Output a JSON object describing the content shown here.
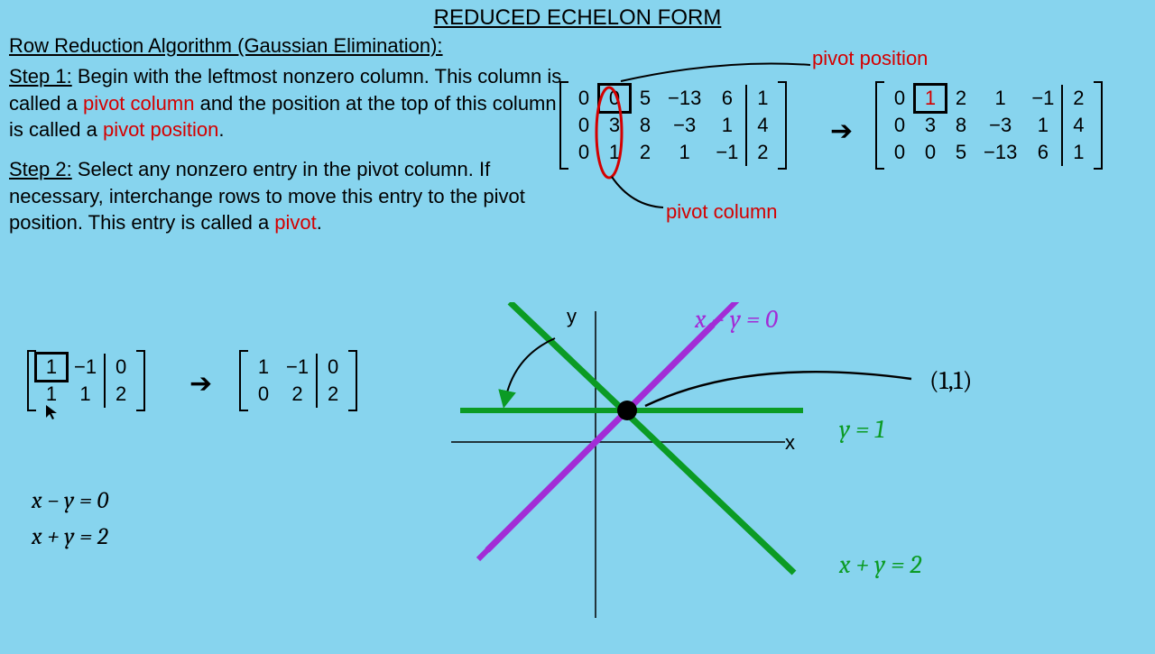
{
  "title": "REDUCED ECHELON FORM",
  "subtitle": "Row Reduction Algorithm (Gaussian Elimination):",
  "labels": {
    "pivot_position": "pivot position",
    "pivot_column": "pivot column"
  },
  "step1": {
    "label": "Step 1:",
    "t1": " Begin with the leftmost nonzero column. This column is called a ",
    "pc": "pivot column",
    "t2": " and the position at the top of this column is called a ",
    "pp": "pivot position",
    "t3": "."
  },
  "step2": {
    "label": "Step 2:",
    "t1": " Select any nonzero entry in the pivot column. If necessary, interchange rows to move this entry to the pivot position. This entry is called a ",
    "pivot": "pivot",
    "t2": "."
  },
  "matrixA": {
    "rows": [
      [
        "0",
        "0",
        "5",
        "−13",
        "6",
        "1"
      ],
      [
        "0",
        "3",
        "8",
        "−3",
        "1",
        "4"
      ],
      [
        "0",
        "1",
        "2",
        "1",
        "−1",
        "2"
      ]
    ]
  },
  "matrixB": {
    "rows": [
      [
        "0",
        "1",
        "2",
        "1",
        "−1",
        "2"
      ],
      [
        "0",
        "3",
        "8",
        "−3",
        "1",
        "4"
      ],
      [
        "0",
        "0",
        "5",
        "−13",
        "6",
        "1"
      ]
    ]
  },
  "matrixC": {
    "rows": [
      [
        "1",
        "−1",
        "0"
      ],
      [
        "1",
        "1",
        "2"
      ]
    ]
  },
  "matrixD": {
    "rows": [
      [
        "1",
        "−1",
        "0"
      ],
      [
        "0",
        "2",
        "2"
      ]
    ]
  },
  "equations": {
    "e1": "x − y = 0",
    "e2": "x + y = 2"
  },
  "graph": {
    "xlabel": "x",
    "ylabel": "y",
    "point_label": "(1,1)",
    "line_purple": "x − y = 0",
    "line_green1": "y = 1",
    "line_green2": "x + y = 2"
  }
}
